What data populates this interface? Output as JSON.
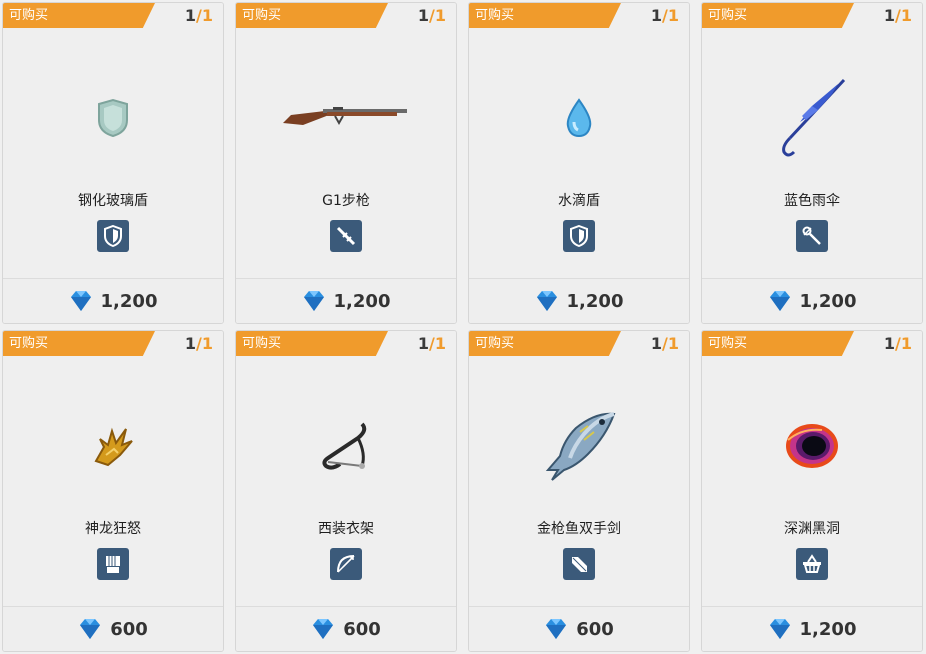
{
  "shop": {
    "items": [
      {
        "tag": "可购买",
        "stock_current": "1",
        "stock_sep": "/",
        "stock_max": "1",
        "name": "钢化玻璃盾",
        "type_icon": "shield-icon",
        "price": "1,200"
      },
      {
        "tag": "可购买",
        "stock_current": "1",
        "stock_sep": "/",
        "stock_max": "1",
        "name": "G1步枪",
        "type_icon": "rifle-icon",
        "price": "1,200"
      },
      {
        "tag": "可购买",
        "stock_current": "1",
        "stock_sep": "/",
        "stock_max": "1",
        "name": "水滴盾",
        "type_icon": "shield-icon",
        "price": "1,200"
      },
      {
        "tag": "可购买",
        "stock_current": "1",
        "stock_sep": "/",
        "stock_max": "1",
        "name": "蓝色雨伞",
        "type_icon": "staff-icon",
        "price": "1,200"
      },
      {
        "tag": "可购买",
        "stock_current": "1",
        "stock_sep": "/",
        "stock_max": "1",
        "name": "神龙狂怒",
        "type_icon": "gauntlet-icon",
        "price": "600"
      },
      {
        "tag": "可购买",
        "stock_current": "1",
        "stock_sep": "/",
        "stock_max": "1",
        "name": "西装衣架",
        "type_icon": "bow-icon",
        "price": "600"
      },
      {
        "tag": "可购买",
        "stock_current": "1",
        "stock_sep": "/",
        "stock_max": "1",
        "name": "金枪鱼双手剑",
        "type_icon": "sword-icon",
        "price": "600"
      },
      {
        "tag": "可购买",
        "stock_current": "1",
        "stock_sep": "/",
        "stock_max": "1",
        "name": "深渊黑洞",
        "type_icon": "basket-icon",
        "price": "1,200"
      }
    ]
  },
  "colors": {
    "tag_orange": "#f09b2c",
    "badge_blue": "#3b5a7a",
    "gem_blue": "#2a8fe0"
  }
}
